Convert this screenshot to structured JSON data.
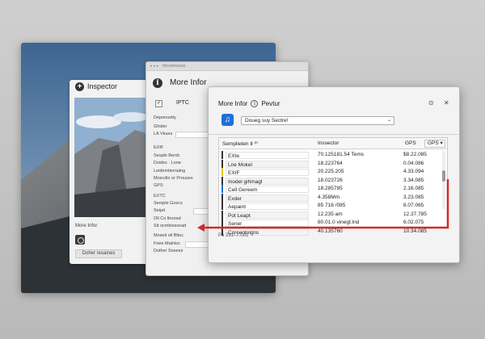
{
  "colors": {
    "accent_red": "#d42a2a",
    "app_icon_blue": "#1e6fd9"
  },
  "photo_window": {
    "inspector_title": "Inspector",
    "more_info_label": "More Infor",
    "button_label": "Doher resaines"
  },
  "info_window": {
    "titlebar_text": "Ifocomnsoox",
    "title": "More Infor",
    "checkbox_mark": "✓",
    "iptc_label": "IPTC",
    "rows": [
      {
        "label": "Depenostty"
      },
      {
        "label": "Ghider"
      },
      {
        "label": "LA Vkues"
      },
      {
        "label": "EXIF"
      },
      {
        "label": "Sexple Berdc"
      },
      {
        "label": "Dsides · Lone"
      },
      {
        "label": "Leidemtierraiing"
      },
      {
        "label": "Moscdlo or Prouses"
      },
      {
        "label": "GPS"
      },
      {
        "label": "EXTC"
      },
      {
        "label": "Semple Goxcs"
      },
      {
        "label": "Seipd"
      },
      {
        "label": "Oll Co ltnorad"
      },
      {
        "label": "Sit ocmbiossoad"
      },
      {
        "label": "Moseit oil Bltoc"
      },
      {
        "label": "Firee Malnloc"
      },
      {
        "label": "Dother Sesees"
      }
    ]
  },
  "dialog": {
    "title": "More Infor",
    "preview_label": "Pevtur",
    "dropdown_value": "Doueg suy Sectre!",
    "table": {
      "headers": [
        "Semplieten Ił ⁽ᶠ⁾",
        "Inssector",
        "GPS",
        "GPS"
      ],
      "rows": [
        {
          "name": "EXte",
          "v1": "70.125181.54 Tems",
          "v2": "$8.22.085",
          "marker": "#333333"
        },
        {
          "name": "Lne Mokel",
          "v1": "18.223764",
          "v2": "0.04.086",
          "marker": "#333333"
        },
        {
          "name": "EXIF",
          "v1": "20.225.205",
          "v2": "4.33.094",
          "marker": "#e8c21a"
        },
        {
          "name": "Inodel gihmagl",
          "v1": "18.023726",
          "v2": "3.34.085",
          "marker": "#333333"
        },
        {
          "name": "Cell Gereem",
          "v1": "18.285785",
          "v2": "2.16.085",
          "marker": "#1e6fd9"
        },
        {
          "name": "Exder",
          "v1": "4.358Mm",
          "v2": "3.23.085",
          "marker": "#333333"
        },
        {
          "name": "Aepaint",
          "v1": "85 716 /085",
          "v2": "8.07.065",
          "marker": "#333333"
        },
        {
          "name": "Pot Leapt",
          "v1": "12.235 am",
          "v2": "12.37.785",
          "marker": "#333333"
        },
        {
          "name": "Sener",
          "v1": "80.01.0 vinegt.lnd",
          "v2": "6.02.075",
          "marker": "#333333"
        },
        {
          "name": "Corcentoigns",
          "v1": "40.135760",
          "v2": "10.34.085",
          "marker": "#333333"
        }
      ]
    },
    "footer": "Po 291–7.001"
  }
}
